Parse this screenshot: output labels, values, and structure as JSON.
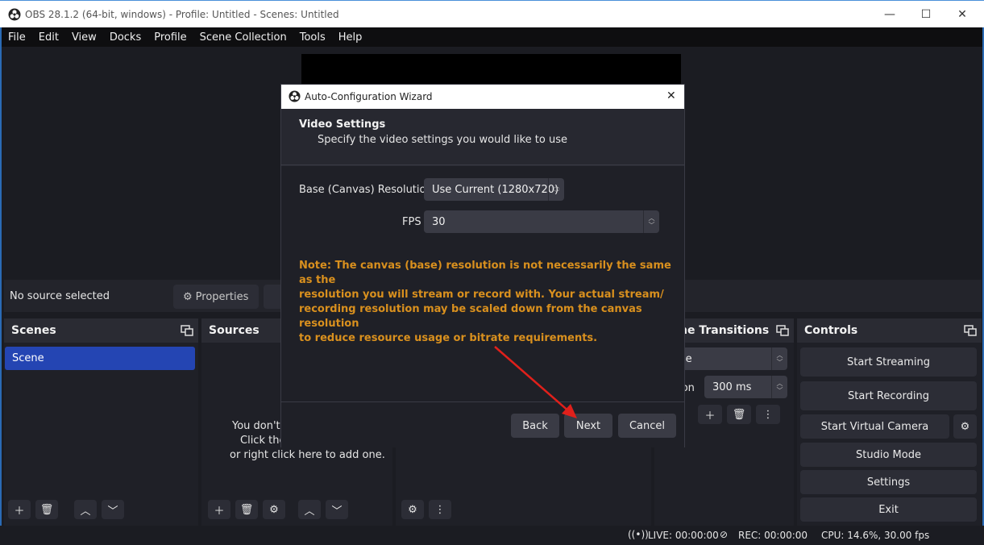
{
  "window": {
    "title": "OBS 28.1.2 (64-bit, windows) - Profile: Untitled - Scenes: Untitled",
    "minimize": "—",
    "maximize": "☐",
    "close": "✕"
  },
  "menu": [
    "File",
    "Edit",
    "View",
    "Docks",
    "Profile",
    "Scene Collection",
    "Tools",
    "Help"
  ],
  "source_bar": {
    "no_source": "No source selected",
    "properties": "Properties"
  },
  "scenes": {
    "title": "Scenes",
    "items": [
      "Scene"
    ]
  },
  "sources": {
    "title": "Sources",
    "empty_line1": "You don't",
    "empty_line2": "Click the",
    "empty_line3": "or right click here to add one."
  },
  "transitions": {
    "title": "ne Transitions",
    "type_partial": "le",
    "duration_label_partial": "tion",
    "duration": "300 ms"
  },
  "controls": {
    "title": "Controls",
    "buttons": [
      "Start Streaming",
      "Start Recording",
      "Start Virtual Camera",
      "Studio Mode",
      "Settings",
      "Exit"
    ]
  },
  "status": {
    "live": "LIVE: 00:00:00",
    "rec": "REC: 00:00:00",
    "cpu": "CPU: 14.6%, 30.00 fps"
  },
  "dialog": {
    "title": "Auto-Configuration Wizard",
    "heading": "Video Settings",
    "subheading": "Specify the video settings you would like to use",
    "resolution_label": "Base (Canvas) Resolution",
    "resolution_value": "Use Current (1280x720)",
    "fps_label": "FPS",
    "fps_value": "30",
    "note_lines": [
      "Note: The canvas (base) resolution is not necessarily the same as the",
      "resolution you will stream or record with. Your actual stream/",
      "recording resolution may be scaled down from the canvas resolution",
      "to reduce resource usage or bitrate requirements."
    ],
    "back": "Back",
    "next": "Next",
    "cancel": "Cancel",
    "close": "✕"
  },
  "colors": {
    "accent": "#2445b3",
    "note": "#d9901e",
    "arrow": "#e0201b"
  }
}
